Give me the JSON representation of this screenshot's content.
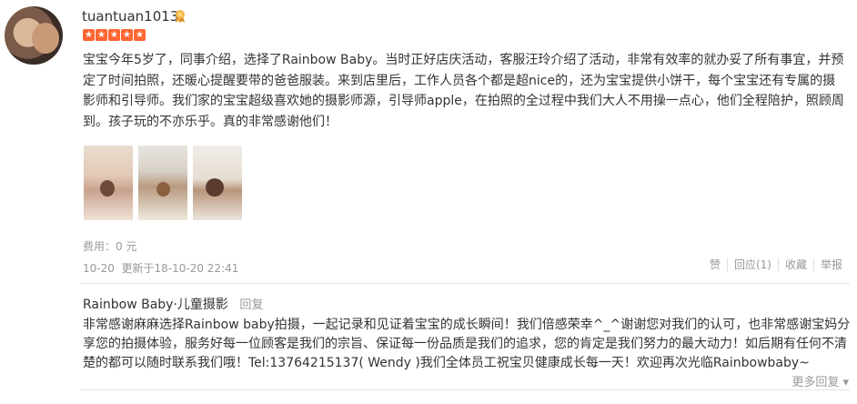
{
  "user": {
    "name": "tuantuan1013",
    "rating": 5
  },
  "review": {
    "text": "宝宝今年5岁了，同事介绍，选择了Rainbow Baby。当时正好店庆活动，客服汪玲介绍了活动，非常有效率的就办妥了所有事宜，并预定了时间拍照，还暖心提醒要带的爸爸服装。来到店里后，工作人员各个都是超nice的，还为宝宝提供小饼干，每个宝宝还有专属的摄影师和引导师。我们家的宝宝超级喜欢她的摄影师源，引导师apple，在拍照的全过程中我们大人不用操一点心，他们全程陪护，照顾周到。孩子玩的不亦乐乎。真的非常感谢他们！"
  },
  "fee": {
    "label": "费用：",
    "value": "0 元"
  },
  "meta": {
    "date": "10-20",
    "updated": "更新于18-10-20 22:41"
  },
  "actions": {
    "like": "赞",
    "reply": "回应(1)",
    "favorite": "收藏",
    "report": "举报"
  },
  "merchant_reply": {
    "name": "Rainbow Baby·儿童摄影",
    "reply_link": "回复",
    "text": "非常感谢麻麻选择Rainbow baby拍摄，一起记录和见证着宝宝的成长瞬间！我们倍感荣幸^_^谢谢您对我们的认可，也非常感谢宝妈分享您的拍摄体验，服务好每一位顾客是我们的宗旨、保证每一份品质是我们的追求，您的肯定是我们努力的最大动力！如后期有任何不清楚的都可以随时联系我们哦！Tel:13764215137( Wendy )我们全体员工祝宝贝健康成长每一天！欢迎再次光临Rainbowbaby~"
  },
  "more_replies": "更多回复 ▾",
  "colors": {
    "star": "#ff6633",
    "muted": "#999999",
    "text": "#333333"
  }
}
